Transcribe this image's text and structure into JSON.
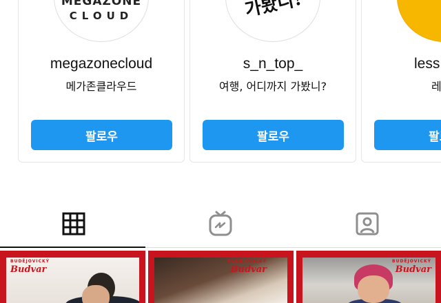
{
  "suggestions": [
    {
      "username": "megazonecloud",
      "fullname": "메가존클라우드",
      "avatar_line1": "MEGAZONE",
      "avatar_line2": "CLOUD",
      "follow_label": "팔로우"
    },
    {
      "username": "s_n_top_",
      "fullname": "여행, 어디까지 가봤니?",
      "avatar_text": "가봤니!",
      "follow_label": "팔로우"
    },
    {
      "username": "less",
      "fullname": "레",
      "follow_label": "팔로우"
    }
  ],
  "tabs": [
    {
      "icon": "grid-icon",
      "selected": true
    },
    {
      "icon": "igtv-icon",
      "selected": false
    },
    {
      "icon": "tagged-icon",
      "selected": false
    }
  ],
  "posts": [
    {
      "brand": "Budvar",
      "brand_top": "BUDĚJOVICKÝ"
    },
    {
      "brand": "Budvar",
      "brand_top": "BUDĚJOVICKÝ"
    },
    {
      "brand": "Budvar",
      "brand_top": "BUDĚJOVICKÝ"
    }
  ],
  "colors": {
    "follow_button": "#1e97f0",
    "post_frame": "#c8141e",
    "avatar_yellow": "#f7b600"
  }
}
